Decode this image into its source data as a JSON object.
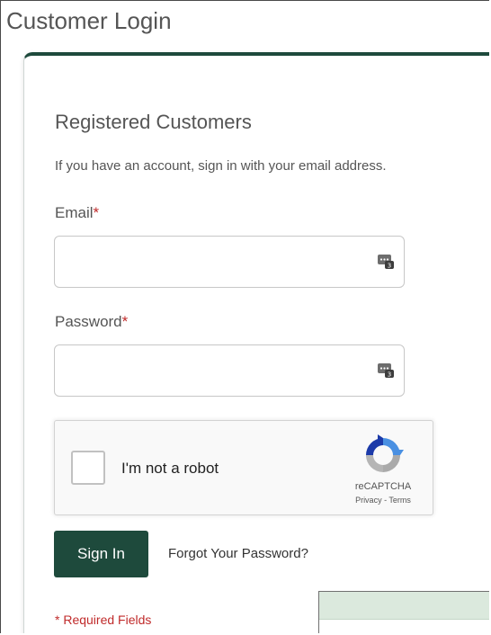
{
  "page": {
    "title": "Customer Login"
  },
  "login_form": {
    "section_title": "Registered Customers",
    "intro": "If you have an account, sign in with your email address.",
    "email": {
      "label": "Email",
      "required_mark": "*",
      "value": "",
      "placeholder": ""
    },
    "password": {
      "label": "Password",
      "required_mark": "*",
      "value": "",
      "placeholder": ""
    },
    "password_manager_icon": "password-manager-icon",
    "signin_label": "Sign In",
    "forgot_label": "Forgot Your Password?",
    "required_note": "* Required Fields"
  },
  "recaptcha": {
    "label": "I'm not a robot",
    "checked": false,
    "brand": "reCAPTCHA",
    "privacy": "Privacy",
    "separator": " - ",
    "terms": "Terms"
  },
  "colors": {
    "brand_green": "#1e4a3c",
    "required_red": "#c02b2b",
    "popup_header": "#dbe9dd"
  }
}
